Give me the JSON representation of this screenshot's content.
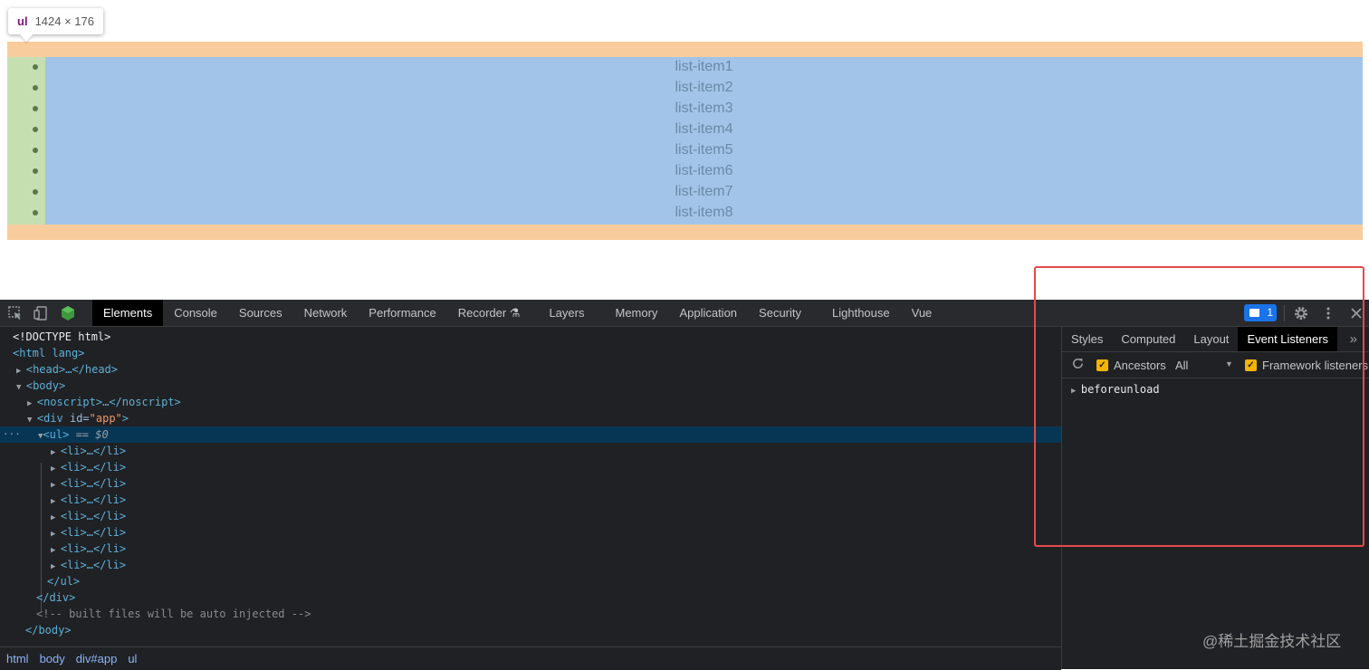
{
  "page": {
    "tooltip": {
      "tag": "ul",
      "dims": "1424 × 176"
    },
    "list_items": [
      "list-item1",
      "list-item2",
      "list-item3",
      "list-item4",
      "list-item5",
      "list-item6",
      "list-item7",
      "list-item8"
    ]
  },
  "devtools": {
    "toolbar": {
      "tabs": [
        "Elements",
        "Console",
        "Sources",
        "Network",
        "Performance",
        "Recorder ⚗",
        "Layers",
        "Memory",
        "Application",
        "Security",
        "Lighthouse",
        "Vue"
      ],
      "active_tab": "Elements",
      "issues_count": "1",
      "icons": [
        "inspect-element-icon",
        "device-toolbar-icon",
        "vue-devtools-icon",
        "settings-gear-icon",
        "more-vertical-icon",
        "close-icon"
      ]
    },
    "elements_tree": {
      "doctype": "<!DOCTYPE html>",
      "html_open": "<html lang>",
      "head": "<head>…</head>",
      "body_open": "<body>",
      "noscript": "<noscript>…</noscript>",
      "div_open_tag": "<div ",
      "div_attr_name": "id=",
      "div_attr_value": "\"app\"",
      "div_close_bracket": ">",
      "ul_open": "<ul>",
      "ul_marker": "== $0",
      "li_row": "<li>…</li>",
      "ul_close": "</ul>",
      "div_close": "</div>",
      "comment": "<!-- built files will be auto injected -->",
      "body_close": "</body>",
      "ellipsis": "…"
    },
    "breadcrumbs": [
      "html",
      "body",
      "div#app",
      "ul"
    ],
    "sidebar": {
      "tabs": [
        "Styles",
        "Computed",
        "Layout",
        "Event Listeners"
      ],
      "active_tab": "Event Listeners",
      "more": "»",
      "ancestors_label": "Ancestors",
      "filter_value": "All",
      "framework_label": "Framework listeners",
      "listener": "beforeunload"
    }
  },
  "watermark": "@稀土掘金技术社区",
  "colors": {
    "margin": "#f8cc9d",
    "padding": "#c6dfb1",
    "content": "#a1c4e8",
    "highlight_box": "#e34b4b",
    "selection": "#073655",
    "accent": "#1a73e8"
  }
}
